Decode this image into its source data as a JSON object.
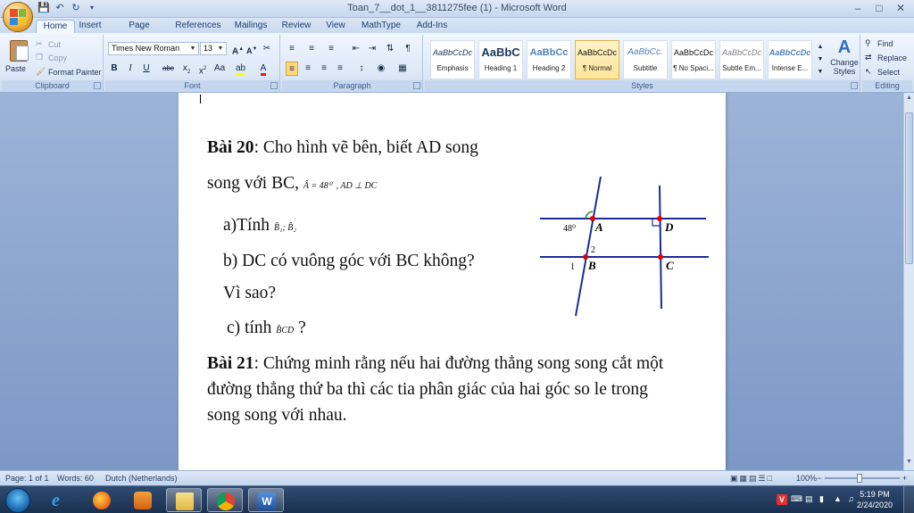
{
  "window": {
    "title": "Toan_7__dot_1__3811275fee (1) - Microsoft Word"
  },
  "tabs": [
    "Home",
    "Insert",
    "Page Layout",
    "References",
    "Mailings",
    "Review",
    "View",
    "MathType",
    "Add-Ins"
  ],
  "clipboard": {
    "paste": "Paste",
    "cut": "Cut",
    "copy": "Copy",
    "format_painter": "Format Painter",
    "label": "Clipboard"
  },
  "font": {
    "name": "Times New Roman",
    "size": "13",
    "label": "Font"
  },
  "paragraph": {
    "label": "Paragraph"
  },
  "styles": {
    "label": "Styles",
    "items": [
      {
        "sample": "AaBbCcDc",
        "name": "Emphasis"
      },
      {
        "sample": "AaBbC",
        "name": "Heading 1"
      },
      {
        "sample": "AaBbCc",
        "name": "Heading 2"
      },
      {
        "sample": "AaBbCcDc",
        "name": "¶ Normal"
      },
      {
        "sample": "AaBbCc.",
        "name": "Subtitle"
      },
      {
        "sample": "AaBbCcDc",
        "name": "¶ No Spaci..."
      },
      {
        "sample": "AaBbCcDc",
        "name": "Subtle Em..."
      },
      {
        "sample": "AaBbCcDc",
        "name": "Intense E..."
      }
    ],
    "change_styles": "Change Styles"
  },
  "editing": {
    "find": "Find",
    "replace": "Replace",
    "select": "Select",
    "label": "Editing"
  },
  "document": {
    "bai20_label": "Bài 20",
    "bai20_text": ": Cho hình vẽ bên, biết AD song",
    "line2_text": "song với BC,",
    "angle_given": "Â = 48⁰",
    "perp_given": ", AD ⊥ DC",
    "qa_text": "a)Tính",
    "qa_math": "B̂₁; B̂₂",
    "qb_text": "b) DC có vuông góc với BC không?",
    "qb2_text": "Vì sao?",
    "qc_text": "c) tính",
    "qc_math": "B̂CD",
    "qc_end": "?",
    "bai21_label": "Bài 21",
    "bai21_line1": ": Chứng minh rằng nếu hai đường thẳng song song cắt một",
    "bai21_line2": "đường thẳng thứ ba thì các tia phân giác của hai góc so le trong",
    "bai21_line3": "song song với nhau."
  },
  "figure": {
    "labels": {
      "A": "A",
      "B": "B",
      "C": "C",
      "D": "D",
      "angle": "48⁰",
      "b1": "1",
      "b2": "2"
    },
    "point_color": "#e00000",
    "line_color": "#1a2a9a"
  },
  "status": {
    "page": "Page: 1 of 1",
    "words": "Words: 60",
    "language": "Dutch (Netherlands)",
    "zoom": "100%"
  },
  "tray": {
    "time": "5:19 PM",
    "date": "2/24/2020"
  }
}
